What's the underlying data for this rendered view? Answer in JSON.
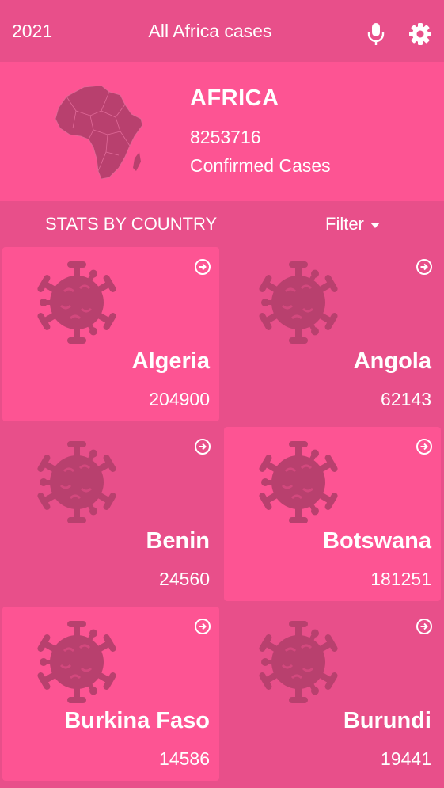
{
  "topbar": {
    "year": "2021",
    "title": "All Africa cases",
    "icons": [
      "mic-icon",
      "gear-icon"
    ]
  },
  "summary": {
    "region": "AFRICA",
    "count": "8253716",
    "label": "Confirmed Cases"
  },
  "stats": {
    "heading": "STATS BY COUNTRY",
    "filter_label": "Filter"
  },
  "countries": [
    {
      "name": "Algeria",
      "cases": "204900"
    },
    {
      "name": "Angola",
      "cases": "62143"
    },
    {
      "name": "Benin",
      "cases": "24560"
    },
    {
      "name": "Botswana",
      "cases": "181251"
    },
    {
      "name": "Burkina Faso",
      "cases": "14586"
    },
    {
      "name": "Burundi",
      "cases": "19441"
    }
  ],
  "colors": {
    "background": "#e84f8a",
    "highlight": "#fd5493",
    "icon": "#b8406e"
  }
}
